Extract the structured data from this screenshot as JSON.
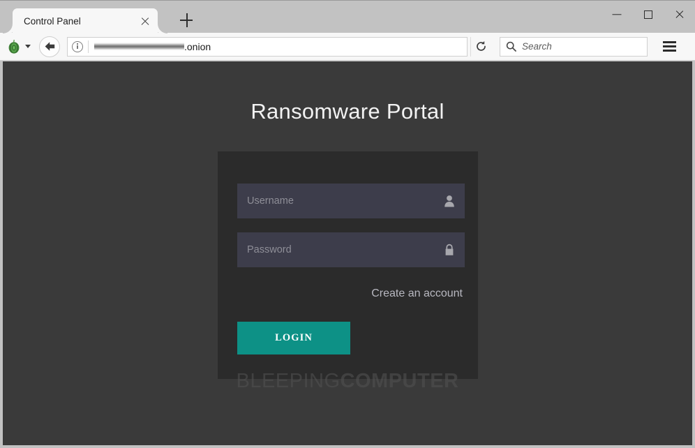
{
  "window": {
    "controls": {
      "minimize_label": "Minimize",
      "maximize_label": "Maximize",
      "close_label": "Close"
    }
  },
  "browser": {
    "tabs": [
      {
        "title": "Control Panel",
        "active": true,
        "close_label": "Close tab"
      }
    ],
    "new_tab_label": "New tab",
    "toolbar": {
      "tor_button_label": "Tor",
      "back_label": "Back",
      "reload_label": "Reload",
      "menu_label": "Open menu",
      "site_info_label": "Site information"
    },
    "address_bar": {
      "url_redacted": true,
      "url_suffix": ".onion"
    },
    "search": {
      "placeholder": "Search",
      "value": ""
    }
  },
  "page": {
    "title": "Ransomware Portal",
    "background_color": "#3a3a3a",
    "card_color": "#2b2b2b",
    "form": {
      "username": {
        "placeholder": "Username",
        "value": "",
        "icon": "user-icon"
      },
      "password": {
        "placeholder": "Password",
        "value": "",
        "icon": "lock-icon"
      },
      "create_account_label": "Create an account",
      "submit_label": "LOGIN",
      "submit_color": "#0d9186",
      "input_color": "#3d3d4b"
    },
    "watermark": {
      "light": "BLEEPING",
      "bold": "COMPUTER"
    }
  }
}
